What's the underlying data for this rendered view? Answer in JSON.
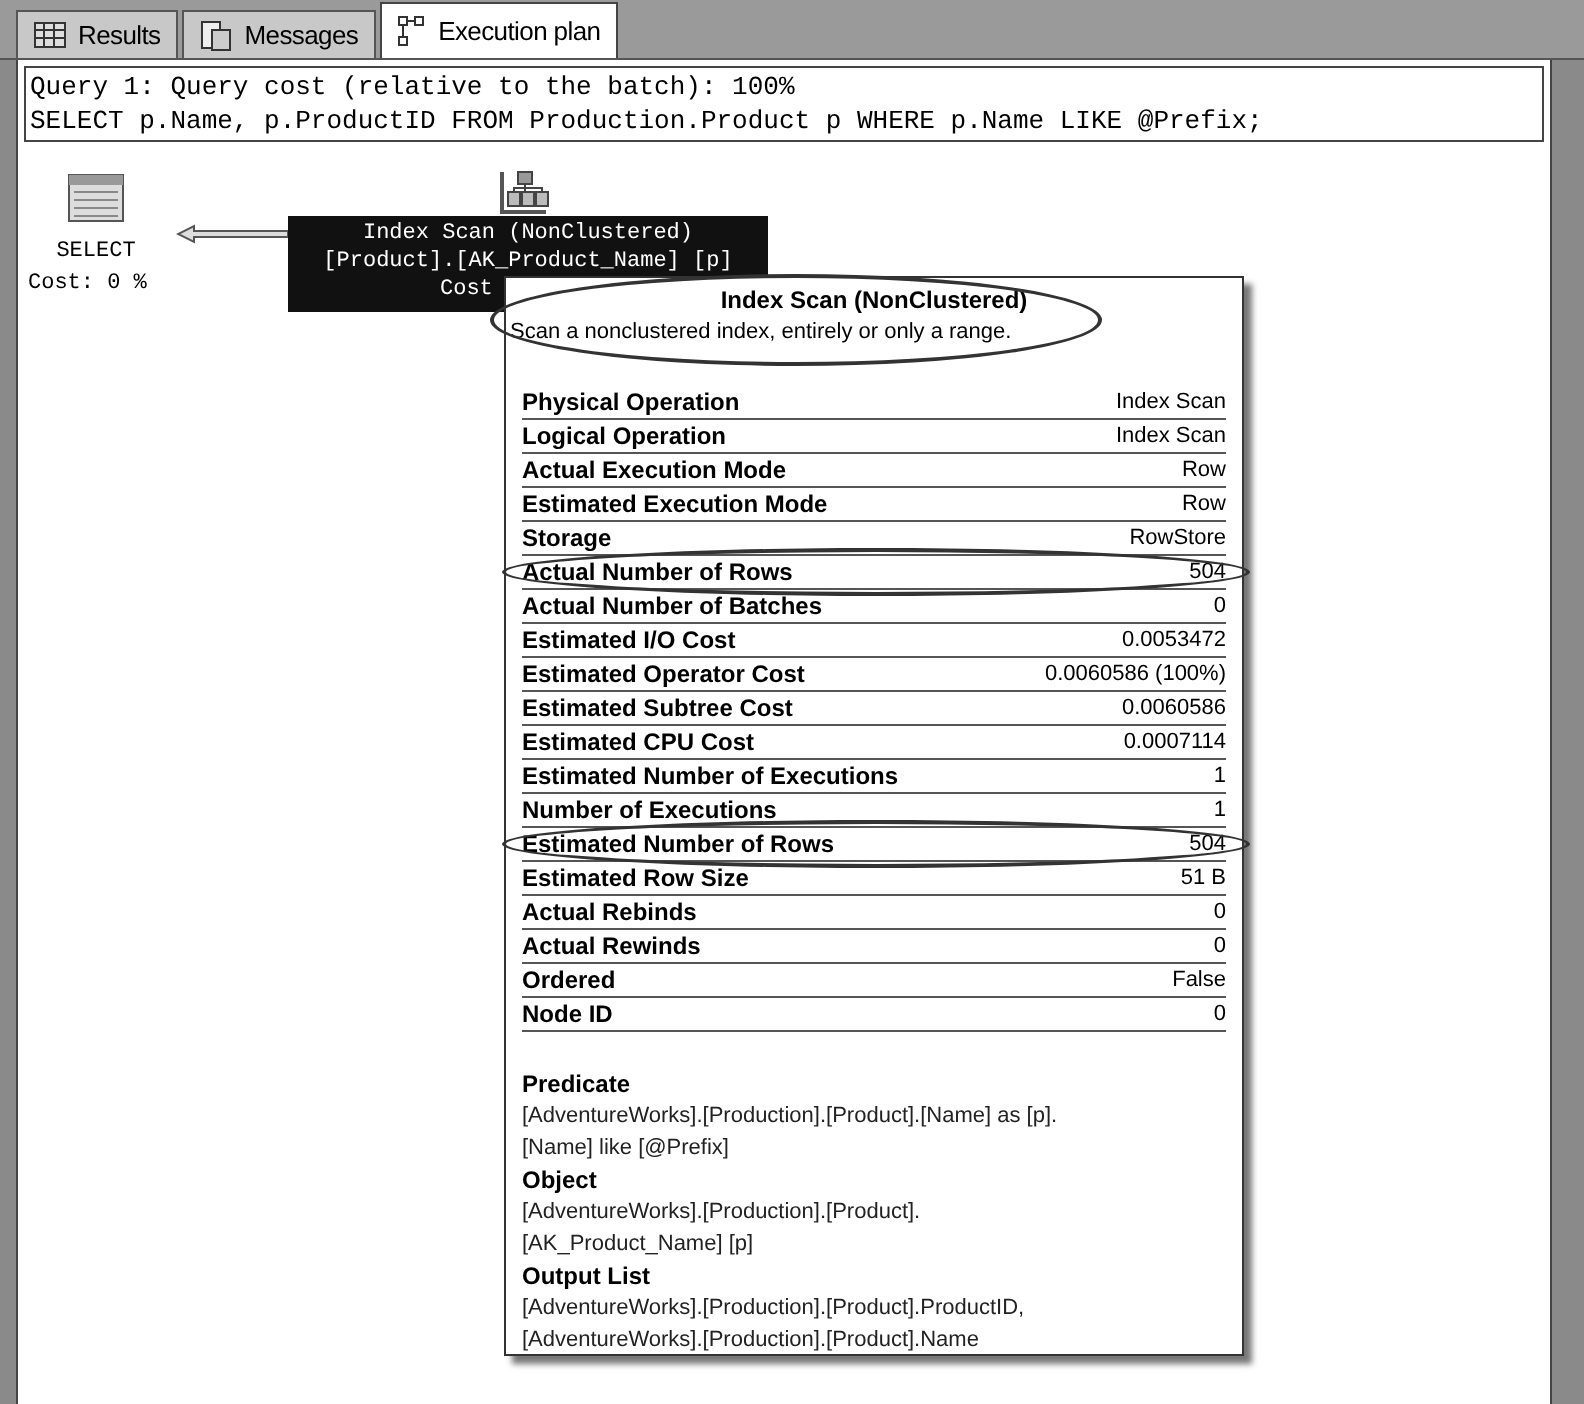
{
  "tabs": [
    {
      "label": "Results",
      "selected": false
    },
    {
      "label": "Messages",
      "selected": false
    },
    {
      "label": "Execution plan",
      "selected": true
    }
  ],
  "query": {
    "cost_line": "Query 1: Query cost (relative to the batch): 100%",
    "sql": "SELECT p.Name, p.ProductID FROM Production.Product p WHERE p.Name LIKE @Prefix;"
  },
  "plan": {
    "select_node": {
      "label": "SELECT",
      "cost": "Cost: 0 %"
    },
    "scan_node": {
      "lines": [
        "Index Scan (NonClustered)",
        "[Product].[AK_Product_Name] [p]",
        "Cost"
      ]
    }
  },
  "tooltip": {
    "title": "Index Scan (NonClustered)",
    "description": "Scan a nonclustered index, entirely or only a range.",
    "circled": true,
    "rows": [
      {
        "label": "Physical Operation",
        "value": "Index Scan",
        "circled": false
      },
      {
        "label": "Logical Operation",
        "value": "Index Scan",
        "circled": false
      },
      {
        "label": "Actual Execution Mode",
        "value": "Row",
        "circled": false
      },
      {
        "label": "Estimated Execution Mode",
        "value": "Row",
        "circled": false
      },
      {
        "label": "Storage",
        "value": "RowStore",
        "circled": false
      },
      {
        "label": "Actual Number of Rows",
        "value": "504",
        "circled": true
      },
      {
        "label": "Actual Number of Batches",
        "value": "0",
        "circled": false
      },
      {
        "label": "Estimated I/O Cost",
        "value": "0.0053472",
        "circled": false
      },
      {
        "label": "Estimated Operator Cost",
        "value": "0.0060586 (100%)",
        "circled": false
      },
      {
        "label": "Estimated Subtree Cost",
        "value": "0.0060586",
        "circled": false
      },
      {
        "label": "Estimated CPU Cost",
        "value": "0.0007114",
        "circled": false
      },
      {
        "label": "Estimated Number of Executions",
        "value": "1",
        "circled": false
      },
      {
        "label": "Number of Executions",
        "value": "1",
        "circled": false
      },
      {
        "label": "Estimated Number of Rows",
        "value": "504",
        "circled": true
      },
      {
        "label": "Estimated Row Size",
        "value": "51 B",
        "circled": false
      },
      {
        "label": "Actual Rebinds",
        "value": "0",
        "circled": false
      },
      {
        "label": "Actual Rewinds",
        "value": "0",
        "circled": false
      },
      {
        "label": "Ordered",
        "value": "False",
        "circled": false
      },
      {
        "label": "Node ID",
        "value": "0",
        "circled": false
      }
    ],
    "sections": [
      {
        "heading": "Predicate",
        "lines": [
          "[AdventureWorks].[Production].[Product].[Name] as [p].",
          "[Name] like [@Prefix]"
        ]
      },
      {
        "heading": "Object",
        "lines": [
          "[AdventureWorks].[Production].[Product].",
          "[AK_Product_Name] [p]"
        ]
      },
      {
        "heading": "Output List",
        "lines": [
          "[AdventureWorks].[Production].[Product].ProductID,",
          "[AdventureWorks].[Production].[Product].Name"
        ]
      }
    ]
  }
}
